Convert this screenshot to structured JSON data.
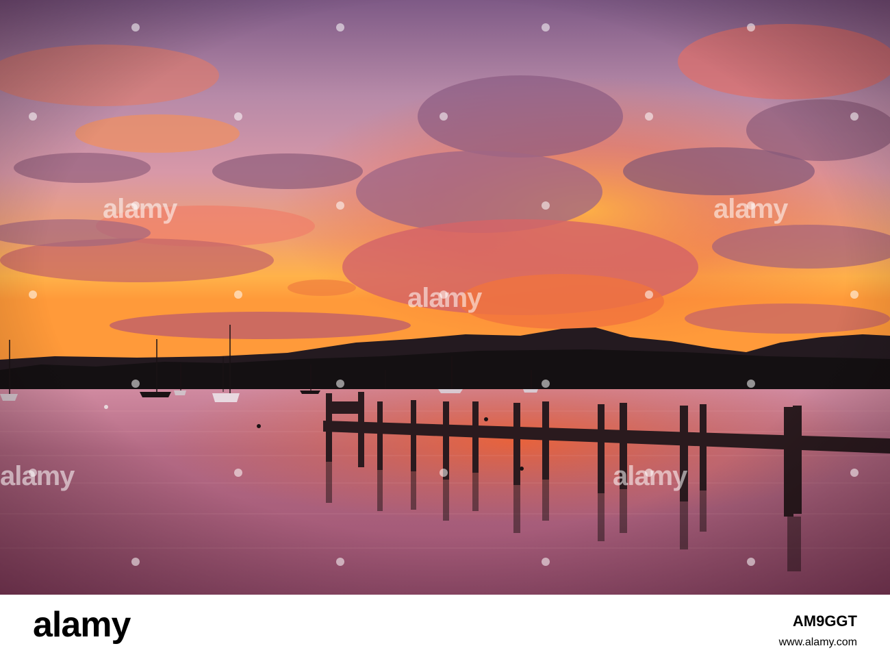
{
  "photo": {
    "scene": "sunset-lake-jetty",
    "colors": {
      "sky_top": "#8a5a86",
      "sky_mid": "#c98aa6",
      "sky_glow": "#f08a3a",
      "horizon": "#ffb24a",
      "hills": "#1a1418",
      "water": "#a8607a",
      "water_glow": "#e8603a",
      "jetty": "#2a1a1e"
    }
  },
  "watermark": {
    "text": "alamy",
    "icon": "alamy-watermark-icon"
  },
  "footer": {
    "brand": "alamy",
    "image_code": "AM9GGT",
    "site": "www.alamy.com"
  }
}
